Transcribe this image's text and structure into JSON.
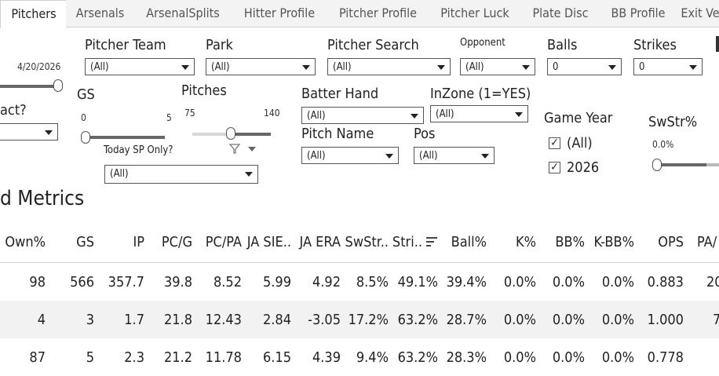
{
  "tabs": [
    "Pitchers",
    "Arsenals",
    "ArsenalSplits",
    "Hitter Profile",
    "Pitcher Profile",
    "Pitcher Luck",
    "Plate Disc",
    "BB Profile",
    "Exit Ve"
  ],
  "filters": {
    "date_value": "4/20/2026",
    "contact_label": "act?",
    "pitcher_team": {
      "label": "Pitcher Team",
      "value": "(All)"
    },
    "park": {
      "label": "Park",
      "value": "(All)"
    },
    "pitcher_search": {
      "label": "Pitcher Search",
      "value": "(All)"
    },
    "opponent": {
      "label": "Opponent",
      "value": "(All)"
    },
    "balls": {
      "label": "Balls",
      "value": "0"
    },
    "strikes": {
      "label": "Strikes",
      "value": "0"
    },
    "gs": {
      "label": "GS",
      "min": "0",
      "max": "5"
    },
    "pitches": {
      "label": "Pitches",
      "min": "75",
      "max": "140"
    },
    "today_sp": {
      "label": "Today SP Only?",
      "value": "(All)"
    },
    "batter_hand": {
      "label": "Batter Hand",
      "value": "(All)"
    },
    "inzone": {
      "label": "InZone (1=YES)",
      "value": "(All)"
    },
    "pitch_name": {
      "label": "Pitch Name",
      "value": "(All)"
    },
    "pos": {
      "label": "Pos",
      "value": "(All)"
    },
    "game_year": {
      "label": "Game Year",
      "options": [
        {
          "label": "(All)",
          "checked": true
        },
        {
          "label": "2026",
          "checked": true
        }
      ]
    },
    "swstr": {
      "label": "SwStr%",
      "min": "0.0%"
    }
  },
  "section_title": "d Metrics",
  "table": {
    "columns": [
      "Own%",
      "GS",
      "IP",
      "PC/G",
      "PC/PA",
      "JA SIE..",
      "JA ERA",
      "SwStr..",
      "Stri..",
      "Ball%",
      "K%",
      "BB%",
      "K-BB%",
      "OPS",
      "PA/"
    ],
    "rows": [
      [
        "98",
        "566",
        "357.7",
        "39.8",
        "8.52",
        "5.99",
        "4.92",
        "8.5%",
        "49.1%",
        "39.4%",
        "0.0%",
        "0.0%",
        "0.0%",
        "0.883",
        "20"
      ],
      [
        "4",
        "3",
        "1.7",
        "21.8",
        "12.43",
        "2.84",
        "-3.05",
        "17.2%",
        "63.2%",
        "28.7%",
        "0.0%",
        "0.0%",
        "0.0%",
        "1.000",
        "7"
      ],
      [
        "87",
        "5",
        "2.3",
        "21.2",
        "11.78",
        "6.15",
        "4.39",
        "9.4%",
        "63.2%",
        "28.3%",
        "0.0%",
        "0.0%",
        "0.0%",
        "0.778",
        ""
      ]
    ]
  }
}
